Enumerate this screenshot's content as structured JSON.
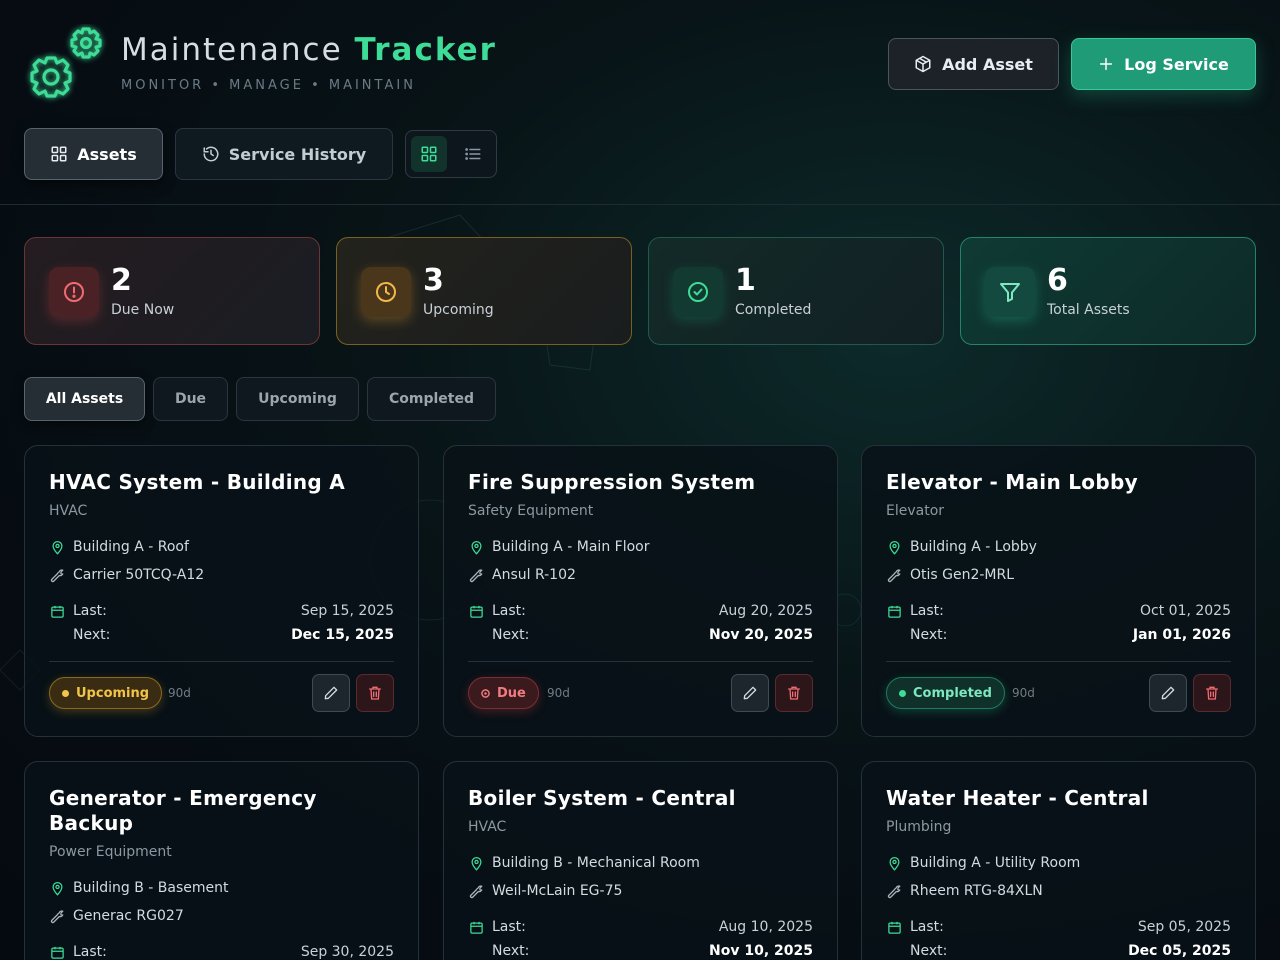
{
  "app": {
    "title_main": "Maintenance",
    "title_accent": "Tracker",
    "subtitle": "MONITOR • MANAGE • MAINTAIN",
    "accent_color": "#3ddc97"
  },
  "header": {
    "add_asset_label": "Add Asset",
    "log_service_label": "Log Service"
  },
  "tabs": {
    "assets_label": "Assets",
    "history_label": "Service History"
  },
  "stats": [
    {
      "value": "2",
      "label": "Due Now",
      "icon": "alert-circle-icon"
    },
    {
      "value": "3",
      "label": "Upcoming",
      "icon": "clock-icon"
    },
    {
      "value": "1",
      "label": "Completed",
      "icon": "check-circle-icon"
    },
    {
      "value": "6",
      "label": "Total Assets",
      "icon": "filter-icon"
    }
  ],
  "filters": {
    "all": "All Assets",
    "due": "Due",
    "upcoming": "Upcoming",
    "completed": "Completed"
  },
  "labels": {
    "last": "Last:",
    "next": "Next:"
  },
  "assets": [
    {
      "name": "HVAC System - Building A",
      "category": "HVAC",
      "location": "Building A - Roof",
      "model": "Carrier 50TCQ-A12",
      "last": "Sep 15, 2025",
      "next": "Dec 15, 2025",
      "status": "Upcoming",
      "interval": "90d"
    },
    {
      "name": "Fire Suppression System",
      "category": "Safety Equipment",
      "location": "Building A - Main Floor",
      "model": "Ansul R-102",
      "last": "Aug 20, 2025",
      "next": "Nov 20, 2025",
      "status": "Due",
      "interval": "90d"
    },
    {
      "name": "Elevator - Main Lobby",
      "category": "Elevator",
      "location": "Building A - Lobby",
      "model": "Otis Gen2-MRL",
      "last": "Oct 01, 2025",
      "next": "Jan 01, 2026",
      "status": "Completed",
      "interval": "90d"
    },
    {
      "name": "Generator - Emergency Backup",
      "category": "Power Equipment",
      "location": "Building B - Basement",
      "model": "Generac RG027",
      "last": "Sep 30, 2025",
      "next": "",
      "status": "",
      "interval": ""
    },
    {
      "name": "Boiler System - Central",
      "category": "HVAC",
      "location": "Building B - Mechanical Room",
      "model": "Weil-McLain EG-75",
      "last": "Aug 10, 2025",
      "next": "Nov 10, 2025",
      "status": "",
      "interval": ""
    },
    {
      "name": "Water Heater - Central",
      "category": "Plumbing",
      "location": "Building A - Utility Room",
      "model": "Rheem RTG-84XLN",
      "last": "Sep 05, 2025",
      "next": "Dec 05, 2025",
      "status": "",
      "interval": ""
    }
  ]
}
